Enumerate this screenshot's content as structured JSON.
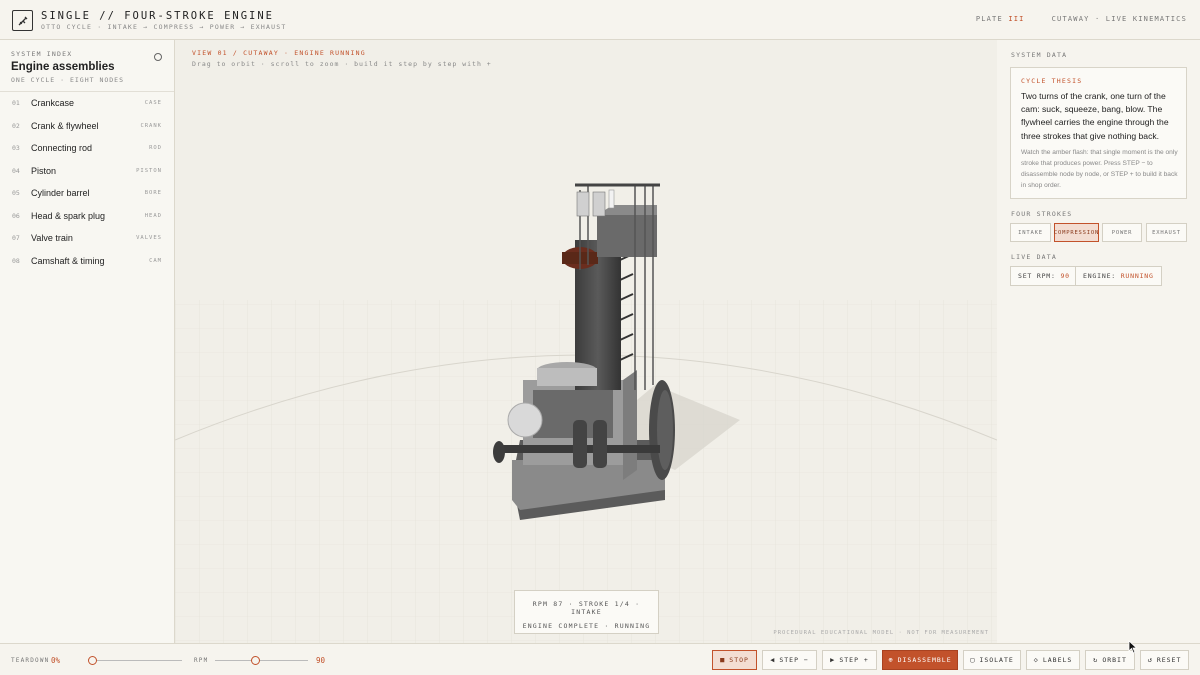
{
  "app": {
    "title": "SINGLE // FOUR-STROKE ENGINE",
    "subtitle": "OTTO CYCLE · INTAKE → COMPRESS → POWER → EXHAUST",
    "plate_label": "PLATE",
    "plate_number": "III",
    "mode": "CUTAWAY · LIVE KINEMATICS"
  },
  "sidebar": {
    "label": "SYSTEM INDEX",
    "title": "Engine assemblies",
    "subtitle": "ONE CYCLE · EIGHT NODES",
    "items": [
      {
        "num": "01",
        "name": "Crankcase",
        "tag": "CASE"
      },
      {
        "num": "02",
        "name": "Crank & flywheel",
        "tag": "CRANK"
      },
      {
        "num": "03",
        "name": "Connecting rod",
        "tag": "ROD"
      },
      {
        "num": "04",
        "name": "Piston",
        "tag": "PISTON"
      },
      {
        "num": "05",
        "name": "Cylinder barrel",
        "tag": "BORE"
      },
      {
        "num": "06",
        "name": "Head & spark plug",
        "tag": "HEAD"
      },
      {
        "num": "07",
        "name": "Valve train",
        "tag": "VALVES"
      },
      {
        "num": "08",
        "name": "Camshaft & timing",
        "tag": "CAM"
      }
    ]
  },
  "viewport": {
    "title": "VIEW 01 / CUTAWAY · ENGINE RUNNING",
    "hint": "Drag to orbit · scroll to zoom · build it step by step with +",
    "status_line1": "RPM 87 · STROKE 1/4 · INTAKE",
    "status_line2": "ENGINE COMPLETE · RUNNING",
    "disclaimer": "PROCEDURAL EDUCATIONAL MODEL · NOT FOR MEASUREMENT"
  },
  "panel": {
    "label": "SYSTEM DATA",
    "thesis_label": "CYCLE THESIS",
    "thesis_text": "Two turns of the crank, one turn of the cam: suck, squeeze, bang, blow. The flywheel carries the engine through the three strokes that give nothing back.",
    "thesis_note": "Watch the amber flash: that single moment is the only stroke that produces power. Press STEP − to disassemble node by node, or STEP + to build it back in shop order.",
    "strokes_label": "FOUR STROKES",
    "strokes": [
      "INTAKE",
      "COMPRESSION",
      "POWER",
      "EXHAUST"
    ],
    "active_stroke": "COMPRESSION",
    "live_label": "LIVE DATA",
    "set_rpm_label": "SET RPM:",
    "set_rpm_value": "90",
    "engine_label": "ENGINE:",
    "engine_value": "RUNNING"
  },
  "controls": {
    "teardown_label": "TEARDOWN",
    "teardown_value": "0%",
    "teardown_fraction": 0.0,
    "rpm_label": "RPM",
    "rpm_value": "90",
    "rpm_fraction": 0.43,
    "stop": "STOP",
    "step_back": "STEP −",
    "step_forward": "STEP +",
    "disassemble": "DISASSEMBLE",
    "isolate": "ISOLATE",
    "labels": "LABELS",
    "orbit": "ORBIT",
    "reset": "RESET"
  },
  "colors": {
    "accent": "#c2522b",
    "background": "#f3f1ea",
    "metal_dark": "#4a4a4a",
    "metal_light": "#9a9a9a"
  }
}
